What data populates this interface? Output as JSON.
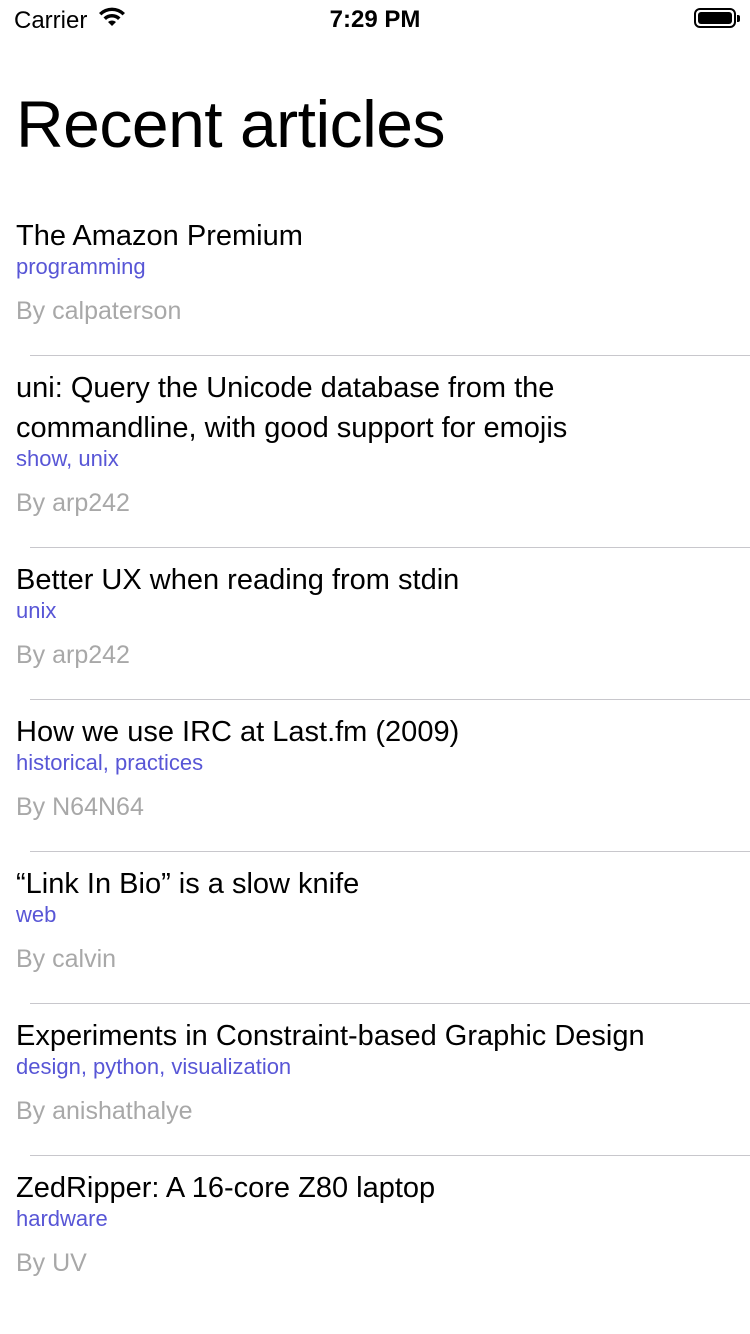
{
  "status_bar": {
    "carrier": "Carrier",
    "time": "7:29 PM",
    "icons": [
      "wifi-icon",
      "battery-icon"
    ]
  },
  "page": {
    "title": "Recent articles"
  },
  "articles": [
    {
      "title": "The Amazon Premium",
      "tags": "programming",
      "author": "By calpaterson"
    },
    {
      "title": "uni: Query the Unicode database from the commandline, with good support for emojis",
      "tags": "show, unix",
      "author": "By arp242"
    },
    {
      "title": "Better UX when reading from stdin",
      "tags": "unix",
      "author": "By arp242"
    },
    {
      "title": "How we use IRC at Last.fm (2009)",
      "tags": "historical, practices",
      "author": "By N64N64"
    },
    {
      "title": "“Link In Bio” is a slow knife",
      "tags": "web",
      "author": "By calvin"
    },
    {
      "title": "Experiments in Constraint-based Graphic Design",
      "tags": "design, python, visualization",
      "author": "By anishathalye"
    },
    {
      "title": "ZedRipper: A 16-core Z80 laptop",
      "tags": "hardware",
      "author": "By UV"
    }
  ],
  "colors": {
    "tag": "#5856d6",
    "author": "#a8a8a8",
    "separator": "#c8c7cc"
  }
}
